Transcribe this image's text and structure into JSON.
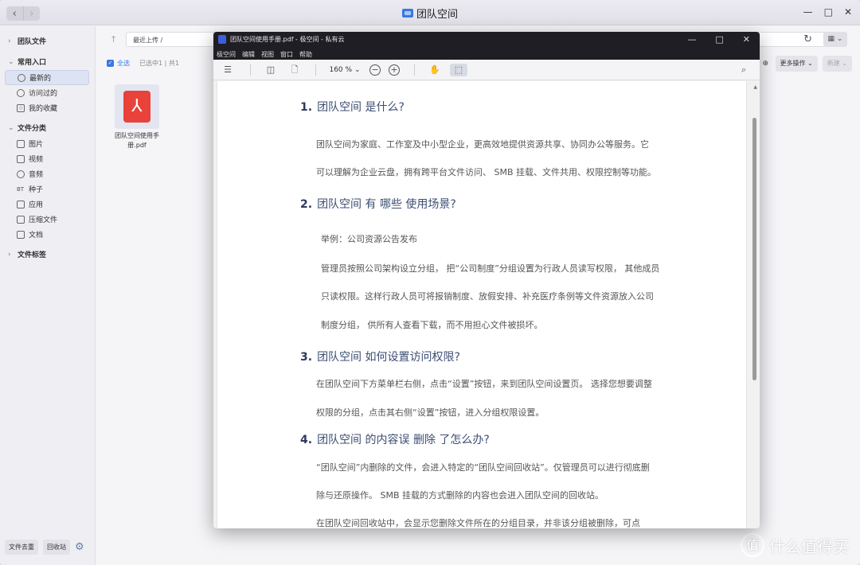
{
  "app": {
    "title": "团队空间",
    "nav_back": "‹",
    "nav_forward": "›",
    "win_minimize": "—",
    "win_maximize": "□",
    "win_close": "✕"
  },
  "sidebar": {
    "group_team": "团队文件",
    "group_common": "常用入口",
    "common_items": [
      {
        "label": "最新的",
        "icon": "clock-icon"
      },
      {
        "label": "访问过的",
        "icon": "history-icon"
      },
      {
        "label": "我的收藏",
        "icon": "star-icon"
      }
    ],
    "group_category": "文件分类",
    "category_items": [
      {
        "label": "图片",
        "icon": "image-icon"
      },
      {
        "label": "视频",
        "icon": "video-icon"
      },
      {
        "label": "音频",
        "icon": "audio-icon"
      },
      {
        "label": "种子",
        "icon": "torrent-icon",
        "glyph": "BT"
      },
      {
        "label": "应用",
        "icon": "app-icon"
      },
      {
        "label": "压缩文件",
        "icon": "archive-icon"
      },
      {
        "label": "文档",
        "icon": "document-icon"
      }
    ],
    "group_tags": "文件标签",
    "footer": {
      "dedupe": "文件去重",
      "recycle": "回收站"
    }
  },
  "toolbar": {
    "path": "最近上传 /",
    "select_all": "全选",
    "selection_info": "已选中1 | 共1",
    "more_actions": "更多操作",
    "new": "新建"
  },
  "file": {
    "name_line1": "团队空间使用手",
    "name_line2": "册.pdf"
  },
  "viewer": {
    "title": "团队空间使用手册.pdf - 极空间 - 私有云",
    "menu": [
      "极空间",
      "编辑",
      "视图",
      "窗口",
      "帮助"
    ],
    "zoom": "160 %",
    "zoom_caret": "⌄"
  },
  "doc": {
    "h1_num": "1.",
    "h1": "团队空间 是什么?",
    "p1a": "团队空间为家庭、工作室及中小型企业，更高效地提供资源共享、协同办公等服务。它",
    "p1b": "可以理解为企业云盘，拥有跨平台文件访问、 SMB 挂载、文件共用、权限控制等功能。",
    "h2_num": "2.",
    "h2": "团队空间 有 哪些 使用场景?",
    "p2a": "举例：公司资源公告发布",
    "p2b": "管理员按照公司架构设立分组， 把“公司制度”分组设置为行政人员读写权限， 其他成员",
    "p2c": "只读权限。这样行政人员可将报销制度、放假安排、补充医疗条例等文件资源放入公司",
    "p2d": "制度分组， 供所有人查看下载，而不用担心文件被损坏。",
    "h3_num": "3.",
    "h3": "团队空间 如何设置访问权限?",
    "p3a": "在团队空间下方菜单栏右侧，点击“设置”按钮，来到团队空间设置页。 选择您想要调整",
    "p3b": "权限的分组，点击其右侧“设置”按钮，进入分组权限设置。",
    "h4_num": "4.",
    "h4": "团队空间 的内容误 删除 了怎么办?",
    "p4a": "“团队空间”内删除的文件，会进入特定的“团队空间回收站”。仅管理员可以进行彻底删",
    "p4b": "除与还原操作。 SMB 挂载的方式删除的内容也会进入团队空间的回收站。",
    "p4c": "在团队空间回收站中，会显示您删除文件所在的分组目录，并非该分组被删除，可点"
  },
  "watermark": {
    "logo": "值",
    "text": "什么值得买"
  },
  "colors": {
    "accent": "#3a78e0",
    "pdf_red": "#e8423a",
    "heading": "#3d4e73",
    "viewer_titlebar": "#1e1e24"
  }
}
